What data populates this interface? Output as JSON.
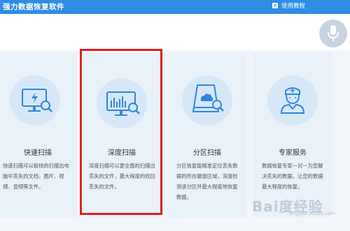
{
  "app": {
    "title": "强力数据恢复软件"
  },
  "header": {
    "tutorial_label": "使用教程"
  },
  "cards": [
    {
      "title": "快速扫描",
      "desc": "快速扫描可以极快的扫描出电脑中丢失的文档、图片、视频、音频等文件。",
      "icon": "monitor-lightning-icon"
    },
    {
      "title": "深度扫描",
      "desc": "深度扫描可以更全面的扫描出丢失的文件，最大程度的找回丢失的文件。",
      "icon": "monitor-chart-icon"
    },
    {
      "title": "分区扫描",
      "desc": "分区恢复能精准定位丢失数据的所在硬盘区域，深度检测该分区并最大程度地恢复数据。",
      "icon": "drive-cloud-icon"
    },
    {
      "title": "专家服务",
      "desc": "数据恢复专家一对一为您解决丢失的数据，让您的数据最大程度的恢复。",
      "icon": "nurse-expert-icon"
    }
  ],
  "watermark": {
    "text": "Bai度经验",
    "sub": "jingyan.baidu.com"
  },
  "colors": {
    "accent": "#2f8de4",
    "icon_blue": "#2e86de",
    "highlight": "#e02020",
    "card_bg": "#e9f1f9"
  }
}
